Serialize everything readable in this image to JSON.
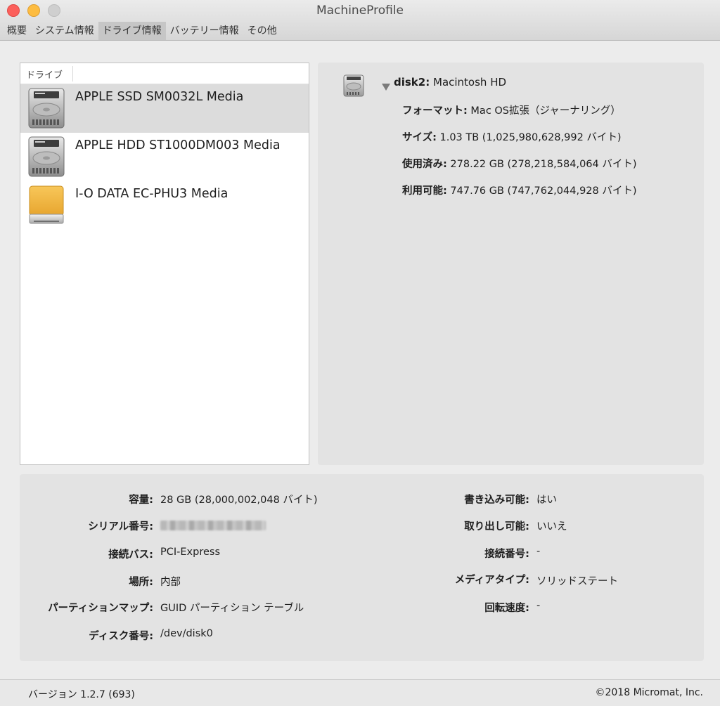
{
  "window": {
    "title": "MachineProfile"
  },
  "tabs": [
    {
      "label": "概要"
    },
    {
      "label": "システム情報"
    },
    {
      "label": "ドライブ情報",
      "active": true
    },
    {
      "label": "バッテリー情報"
    },
    {
      "label": "その他"
    }
  ],
  "drive_list": {
    "header": "ドライブ",
    "items": [
      {
        "label": "APPLE SSD SM0032L Media",
        "icon": "internal-drive-icon",
        "selected": true
      },
      {
        "label": "APPLE HDD ST1000DM003 Media",
        "icon": "internal-drive-icon"
      },
      {
        "label": "I-O DATA EC-PHU3 Media",
        "icon": "external-drive-icon"
      }
    ]
  },
  "volume": {
    "name_key": "disk2:",
    "name_value": "Macintosh HD",
    "props": [
      {
        "key": "フォーマット:",
        "value": "Mac OS拡張（ジャーナリング）"
      },
      {
        "key": "サイズ:",
        "value": "1.03 TB (1,025,980,628,992 バイト)"
      },
      {
        "key": "使用済み:",
        "value": "278.22 GB (278,218,584,064 バイト)"
      },
      {
        "key": "利用可能:",
        "value": "747.76 GB (747,762,044,928 バイト)"
      }
    ]
  },
  "info": {
    "left": [
      {
        "key": "容量:",
        "value": "28 GB (28,000,002,048 バイト)"
      },
      {
        "key": "シリアル番号:",
        "value": ""
      },
      {
        "key": "接続バス:",
        "value": "PCI-Express"
      },
      {
        "key": "場所:",
        "value": "内部"
      },
      {
        "key": "パーティションマップ:",
        "value": "GUID パーティション テーブル"
      },
      {
        "key": "ディスク番号:",
        "value": "/dev/disk0"
      }
    ],
    "right": [
      {
        "key": "書き込み可能:",
        "value": "はい"
      },
      {
        "key": "取り出し可能:",
        "value": "いいえ"
      },
      {
        "key": "接続番号:",
        "value": "-"
      },
      {
        "key": "メディアタイプ:",
        "value": "ソリッドステート"
      },
      {
        "key": "回転速度:",
        "value": "-"
      }
    ]
  },
  "footer": {
    "version": "バージョン 1.2.7 (693)",
    "copyright": "©2018 Micromat, Inc."
  },
  "colors": {
    "close": "#fc605c",
    "minimize": "#fdbc40",
    "zoom_disabled": "#cfcfcf",
    "selection": "#dcdcdc",
    "external_drive": "#f0b440"
  }
}
